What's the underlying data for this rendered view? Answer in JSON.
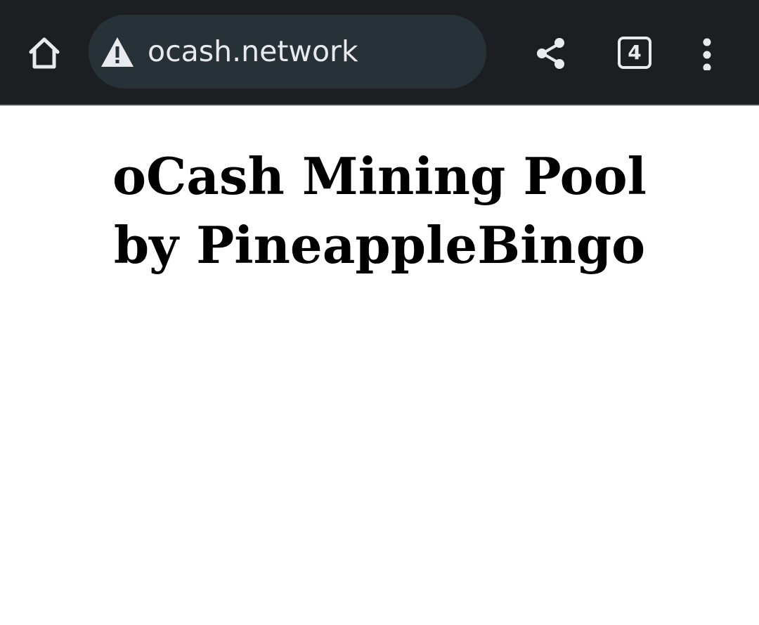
{
  "browser": {
    "url": "ocash.network",
    "tab_count": "4",
    "colors": {
      "toolbar_bg": "#1c1f22",
      "url_bar_bg": "#263238",
      "icon": "#e8eaed"
    },
    "icons": [
      "home-icon",
      "warning-icon",
      "share-icon",
      "tabs-icon",
      "more-vert-icon"
    ]
  },
  "page": {
    "title_line1": "oCash Mining Pool",
    "title_line2": "by PineappleBingo"
  }
}
